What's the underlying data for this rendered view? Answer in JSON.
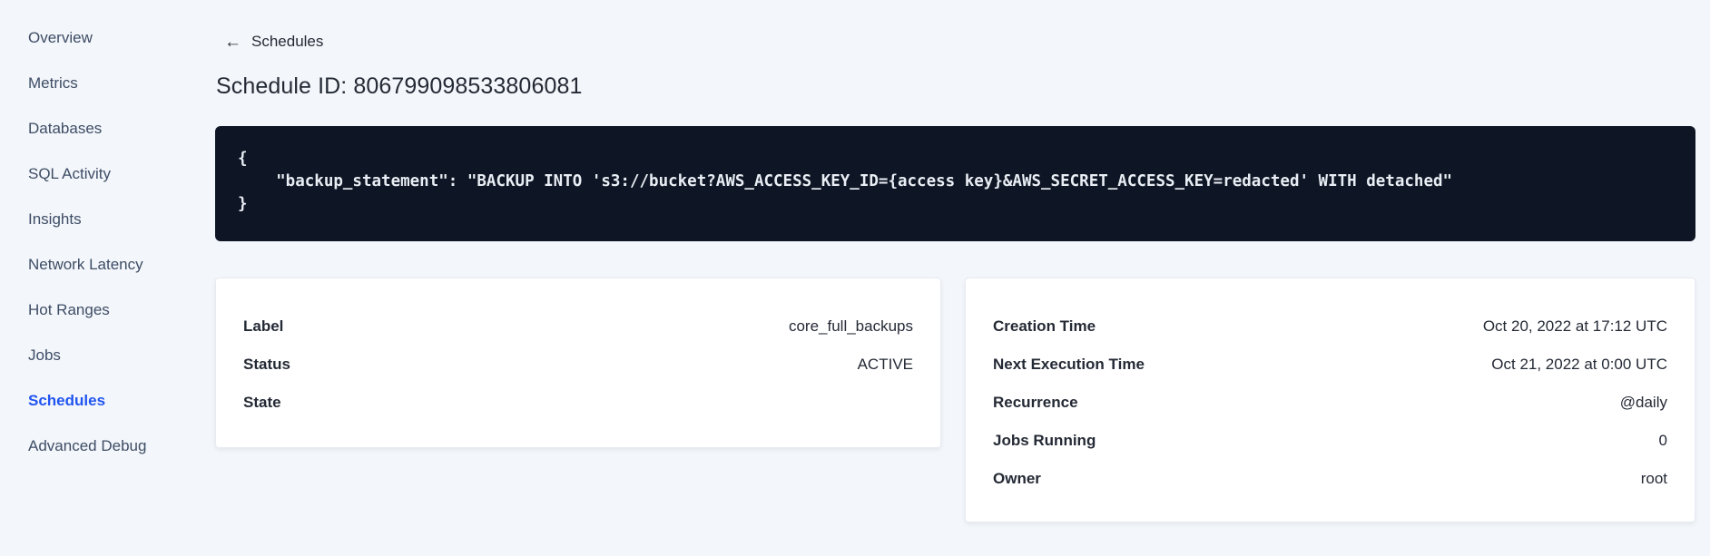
{
  "colors": {
    "accent": "#2155f0",
    "page_background": "#f3f6fa",
    "code_background": "#0e1524",
    "code_text": "#e9edf4",
    "nav_text": "#3e4d66",
    "text_dark": "#242a35"
  },
  "sidebar": {
    "items": [
      {
        "label": "Overview",
        "active": false
      },
      {
        "label": "Metrics",
        "active": false
      },
      {
        "label": "Databases",
        "active": false
      },
      {
        "label": "SQL Activity",
        "active": false
      },
      {
        "label": "Insights",
        "active": false
      },
      {
        "label": "Network Latency",
        "active": false
      },
      {
        "label": "Hot Ranges",
        "active": false
      },
      {
        "label": "Jobs",
        "active": false
      },
      {
        "label": "Schedules",
        "active": true
      },
      {
        "label": "Advanced Debug",
        "active": false
      }
    ]
  },
  "header": {
    "back_icon_glyph": "←",
    "back_label": "Schedules",
    "title": "Schedule ID: 806799098533806081"
  },
  "code_block": {
    "content": "{\n    \"backup_statement\": \"BACKUP INTO 's3://bucket?AWS_ACCESS_KEY_ID={access key}&AWS_SECRET_ACCESS_KEY=redacted' WITH detached\"\n}"
  },
  "details_card": {
    "rows": [
      {
        "label": "Label",
        "value": "core_full_backups"
      },
      {
        "label": "Status",
        "value": "ACTIVE"
      },
      {
        "label": "State",
        "value": ""
      }
    ]
  },
  "schedule_card": {
    "rows": [
      {
        "label": "Creation Time",
        "value": "Oct 20, 2022 at 17:12 UTC"
      },
      {
        "label": "Next Execution Time",
        "value": "Oct 21, 2022 at 0:00 UTC"
      },
      {
        "label": "Recurrence",
        "value": "@daily"
      },
      {
        "label": "Jobs Running",
        "value": "0"
      },
      {
        "label": "Owner",
        "value": "root"
      }
    ]
  }
}
